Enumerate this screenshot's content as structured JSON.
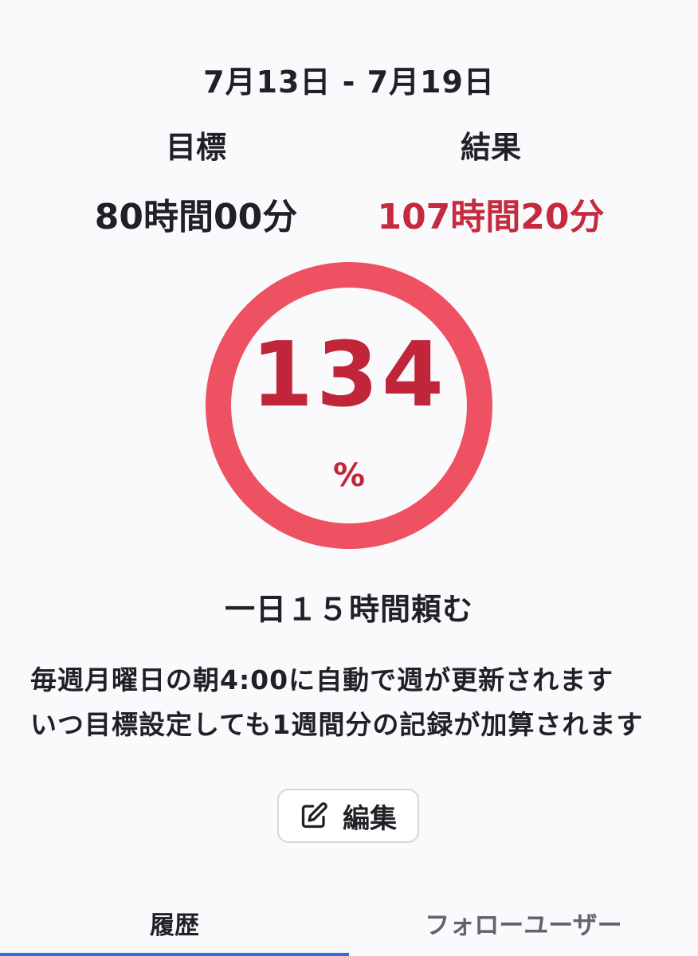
{
  "week": {
    "range": "7月13日 - 7月19日"
  },
  "goal": {
    "label": "目標",
    "value": "80時間00分"
  },
  "result": {
    "label": "結果",
    "value": "107時間20分"
  },
  "progress": {
    "percent": "134",
    "unit": "%",
    "fraction": 1.0,
    "ring_color": "#ee5161"
  },
  "daily": {
    "text": "一日１５時間頼む"
  },
  "notes": [
    "毎週月曜日の朝4:00に自動で週が更新されます",
    "いつ目標設定しても1週間分の記録が加算されます"
  ],
  "edit_button": {
    "label": "編集",
    "icon": "edit-icon"
  },
  "tabs": [
    {
      "label": "履歴",
      "active": true
    },
    {
      "label": "フォローユーザー",
      "active": false
    }
  ],
  "colors": {
    "accent_red": "#c0253a",
    "tab_indicator": "#2f6fd6"
  }
}
